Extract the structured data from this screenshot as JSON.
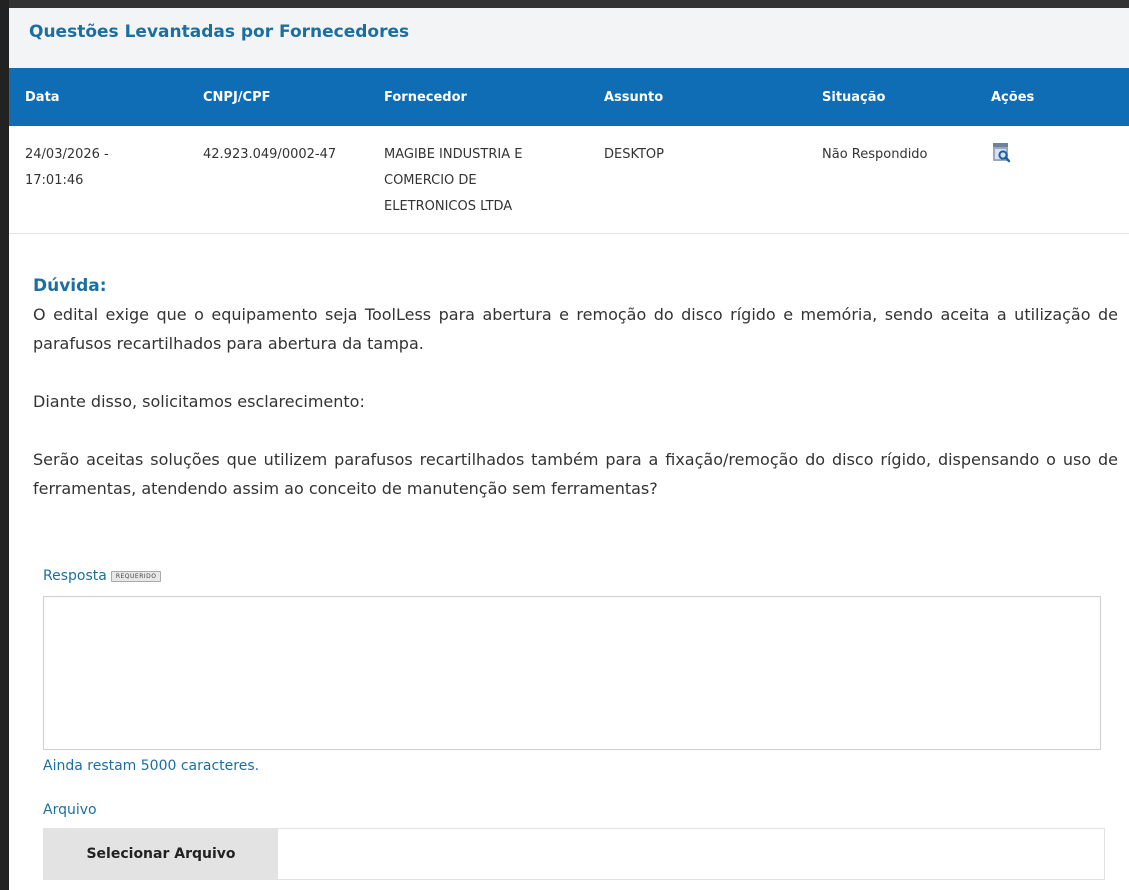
{
  "panel": {
    "title": "Questões Levantadas por Fornecedores"
  },
  "table": {
    "columns": [
      "Data",
      "CNPJ/CPF",
      "Fornecedor",
      "Assunto",
      "Situação",
      "Ações"
    ],
    "rows": [
      {
        "data": "24/03/2026 - 17:01:46",
        "cnpj": "42.923.049/0002-47",
        "fornecedor": "MAGIBE INDUSTRIA E COMERCIO DE ELETRONICOS LTDA",
        "assunto": "DESKTOP",
        "situacao": "Não Respondido",
        "acao_icon": "search-document-icon"
      }
    ]
  },
  "duvida": {
    "label": "Dúvida:",
    "paragraphs": [
      "O edital exige que o equipamento seja ToolLess para abertura e remoção do disco rígido e memória, sendo aceita a utilização de parafusos recartilhados para abertura da tampa.",
      "Diante disso, solicitamos esclarecimento:",
      "Serão aceitas soluções que utilizem parafusos recartilhados também para a fixação/remoção do disco rígido, dispensando o uso de ferramentas, atendendo assim ao conceito de manutenção sem ferramentas?"
    ]
  },
  "resposta": {
    "label": "Resposta",
    "required_badge": "REQUERIDO",
    "value": "",
    "remaining": "Ainda restam 5000 caracteres."
  },
  "arquivo": {
    "label": "Arquivo",
    "button": "Selecionar Arquivo"
  },
  "colors": {
    "header_blue": "#0f6db5",
    "title_blue": "#1b6fa0"
  }
}
